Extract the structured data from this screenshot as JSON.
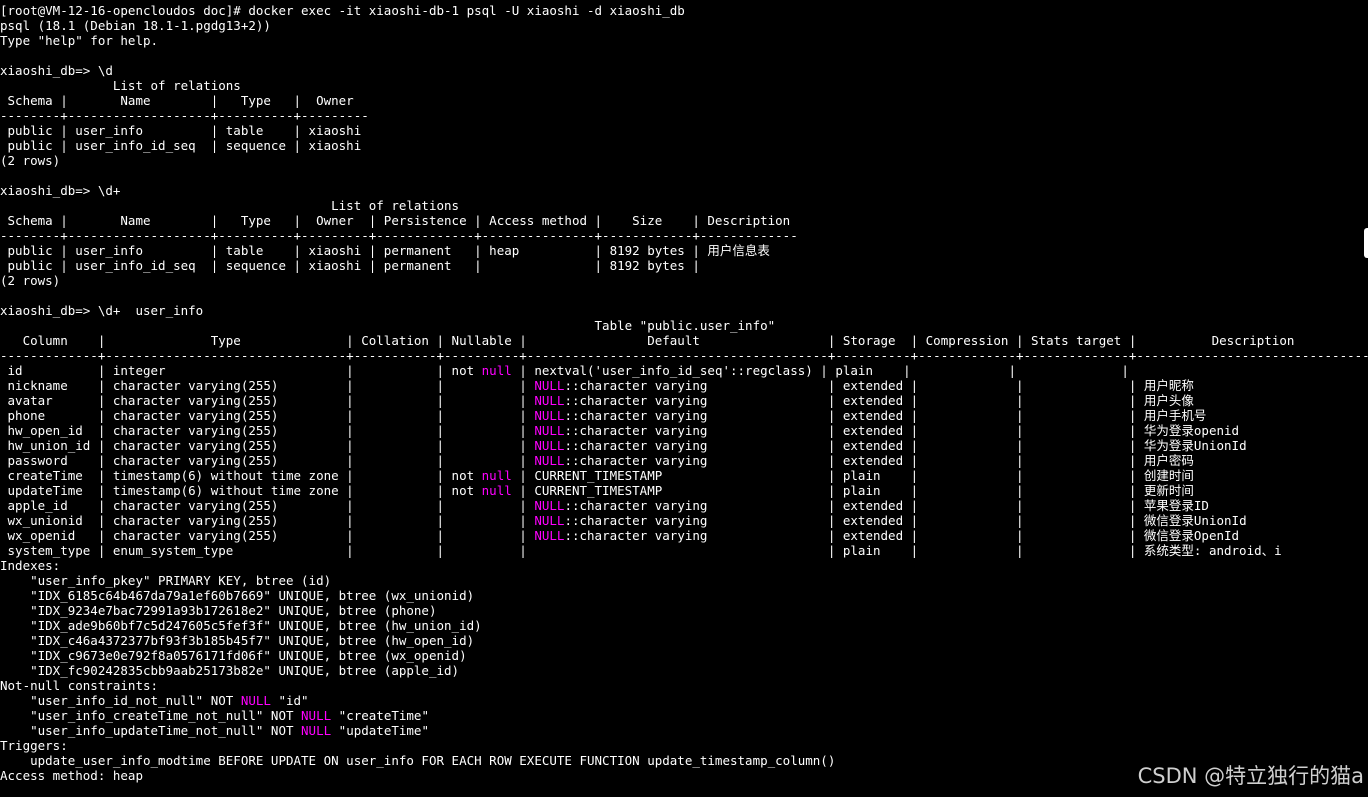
{
  "terminal": {
    "background": "#000000",
    "foreground": "#ffffff",
    "keyword_color": "#ff00ff",
    "lines": [
      [
        {
          "t": "[root@VM-12-16-opencloudos doc]# docker exec -it xiaoshi-db-1 psql -U xiaoshi -d xiaoshi_db"
        }
      ],
      [
        {
          "t": "psql (18.1 (Debian 18.1-1.pgdg13+2))"
        }
      ],
      [
        {
          "t": "Type \"help\" for help."
        }
      ],
      [
        {
          "t": ""
        }
      ],
      [
        {
          "t": "xiaoshi_db=> \\d"
        }
      ],
      [
        {
          "t": "               List of relations"
        }
      ],
      [
        {
          "t": " Schema |       Name        |   Type   |  Owner"
        }
      ],
      [
        {
          "t": "--------+-------------------+----------+---------"
        }
      ],
      [
        {
          "t": " public | user_info         | table    | xiaoshi"
        }
      ],
      [
        {
          "t": " public | user_info_id_seq  | sequence | xiaoshi"
        }
      ],
      [
        {
          "t": "(2 rows)"
        }
      ],
      [
        {
          "t": ""
        }
      ],
      [
        {
          "t": "xiaoshi_db=> \\d+"
        }
      ],
      [
        {
          "t": "                                            List of relations"
        }
      ],
      [
        {
          "t": " Schema |       Name        |   Type   |  Owner  | Persistence | Access method |    Size    | Description"
        }
      ],
      [
        {
          "t": "--------+-------------------+----------+---------+-------------+---------------+------------+-------------"
        }
      ],
      [
        {
          "t": " public | user_info         | table    | xiaoshi | permanent   | heap          | 8192 bytes | 用户信息表"
        }
      ],
      [
        {
          "t": " public | user_info_id_seq  | sequence | xiaoshi | permanent   |               | 8192 bytes |"
        }
      ],
      [
        {
          "t": "(2 rows)"
        }
      ],
      [
        {
          "t": ""
        }
      ],
      [
        {
          "t": "xiaoshi_db=> \\d+  user_info"
        }
      ],
      [
        {
          "t": "                                                                               Table \"public.user_info\""
        }
      ],
      [
        {
          "t": "   Column    |              Type              | Collation | Nullable |                Default                 | Storage  | Compression | Stats target |          Description"
        }
      ],
      [
        {
          "t": "-------------+--------------------------------+-----------+----------+----------------------------------------+----------+-------------+--------------+-------------------------------"
        }
      ],
      [
        {
          "t": " id          | integer                        |           | not "
        },
        {
          "t": "null",
          "k": true
        },
        {
          "t": " | nextval('user_info_id_seq'::regclass) | plain    |             |              |"
        }
      ],
      [
        {
          "t": " nickname    | character varying(255)         |           |          | "
        },
        {
          "t": "NULL",
          "k": true
        },
        {
          "t": "::character varying                | extended |             |              | 用户昵称"
        }
      ],
      [
        {
          "t": " avatar      | character varying(255)         |           |          | "
        },
        {
          "t": "NULL",
          "k": true
        },
        {
          "t": "::character varying                | extended |             |              | 用户头像"
        }
      ],
      [
        {
          "t": " phone       | character varying(255)         |           |          | "
        },
        {
          "t": "NULL",
          "k": true
        },
        {
          "t": "::character varying                | extended |             |              | 用户手机号"
        }
      ],
      [
        {
          "t": " hw_open_id  | character varying(255)         |           |          | "
        },
        {
          "t": "NULL",
          "k": true
        },
        {
          "t": "::character varying                | extended |             |              | 华为登录openid"
        }
      ],
      [
        {
          "t": " hw_union_id | character varying(255)         |           |          | "
        },
        {
          "t": "NULL",
          "k": true
        },
        {
          "t": "::character varying                | extended |             |              | 华为登录UnionId"
        }
      ],
      [
        {
          "t": " password    | character varying(255)         |           |          | "
        },
        {
          "t": "NULL",
          "k": true
        },
        {
          "t": "::character varying                | extended |             |              | 用户密码"
        }
      ],
      [
        {
          "t": " createTime  | timestamp(6) without time zone |           | not "
        },
        {
          "t": "null",
          "k": true
        },
        {
          "t": " | CURRENT_TIMESTAMP                      | plain    |             |              | 创建时间"
        }
      ],
      [
        {
          "t": " updateTime  | timestamp(6) without time zone |           | not "
        },
        {
          "t": "null",
          "k": true
        },
        {
          "t": " | CURRENT_TIMESTAMP                      | plain    |             |              | 更新时间"
        }
      ],
      [
        {
          "t": " apple_id    | character varying(255)         |           |          | "
        },
        {
          "t": "NULL",
          "k": true
        },
        {
          "t": "::character varying                | extended |             |              | 苹果登录ID"
        }
      ],
      [
        {
          "t": " wx_unionid  | character varying(255)         |           |          | "
        },
        {
          "t": "NULL",
          "k": true
        },
        {
          "t": "::character varying                | extended |             |              | 微信登录UnionId"
        }
      ],
      [
        {
          "t": " wx_openid   | character varying(255)         |           |          | "
        },
        {
          "t": "NULL",
          "k": true
        },
        {
          "t": "::character varying                | extended |             |              | 微信登录OpenId"
        }
      ],
      [
        {
          "t": " system_type | enum_system_type               |           |          |                                        | plain    |             |              | 系统类型: android、i"
        }
      ],
      [
        {
          "t": "Indexes:"
        }
      ],
      [
        {
          "t": "    \"user_info_pkey\" PRIMARY KEY, btree (id)"
        }
      ],
      [
        {
          "t": "    \"IDX_6185c64b467da79a1ef60b7669\" UNIQUE, btree (wx_unionid)"
        }
      ],
      [
        {
          "t": "    \"IDX_9234e7bac72991a93b172618e2\" UNIQUE, btree (phone)"
        }
      ],
      [
        {
          "t": "    \"IDX_ade9b60bf7c5d247605c5fef3f\" UNIQUE, btree (hw_union_id)"
        }
      ],
      [
        {
          "t": "    \"IDX_c46a4372377bf93f3b185b45f7\" UNIQUE, btree (hw_open_id)"
        }
      ],
      [
        {
          "t": "    \"IDX_c9673e0e792f8a0576171fd06f\" UNIQUE, btree (wx_openid)"
        }
      ],
      [
        {
          "t": "    \"IDX_fc90242835cbb9aab25173b82e\" UNIQUE, btree (apple_id)"
        }
      ],
      [
        {
          "t": "Not-null constraints:"
        }
      ],
      [
        {
          "t": "    \"user_info_id_not_null\" NOT "
        },
        {
          "t": "NULL",
          "k": true
        },
        {
          "t": " \"id\""
        }
      ],
      [
        {
          "t": "    \"user_info_createTime_not_null\" NOT "
        },
        {
          "t": "NULL",
          "k": true
        },
        {
          "t": " \"createTime\""
        }
      ],
      [
        {
          "t": "    \"user_info_updateTime_not_null\" NOT "
        },
        {
          "t": "NULL",
          "k": true
        },
        {
          "t": " \"updateTime\""
        }
      ],
      [
        {
          "t": "Triggers:"
        }
      ],
      [
        {
          "t": "    update_user_info_modtime BEFORE UPDATE ON user_info FOR EACH ROW EXECUTE FUNCTION update_timestamp_column()"
        }
      ],
      [
        {
          "t": "Access method: heap"
        }
      ]
    ]
  },
  "watermark": {
    "text": "CSDN @特立独行的猫a"
  }
}
